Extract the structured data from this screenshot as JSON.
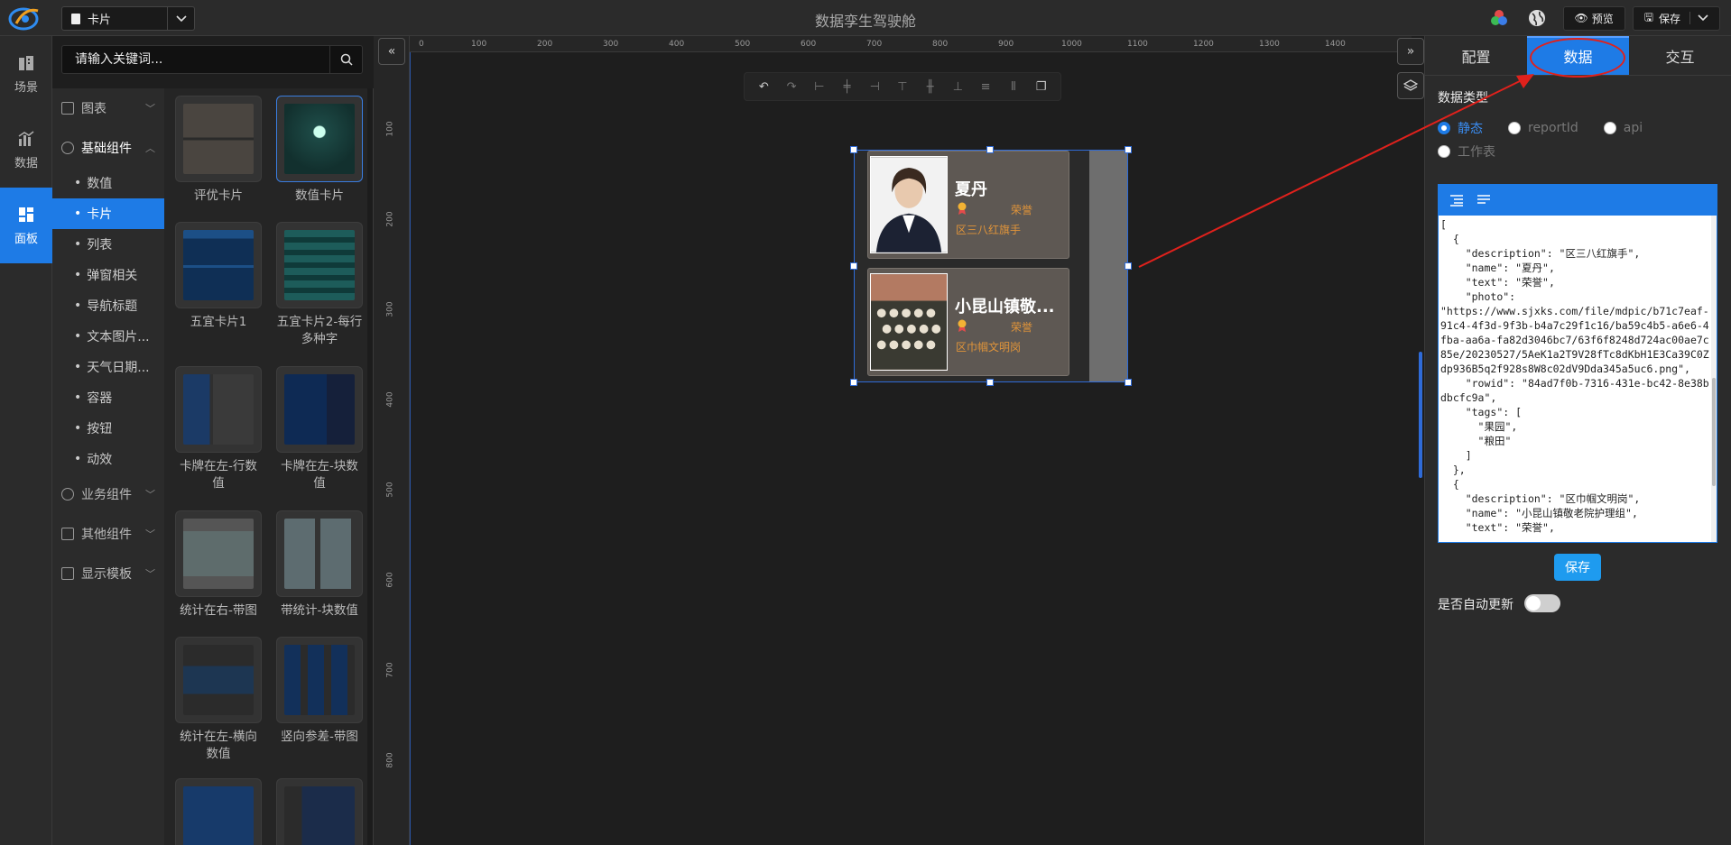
{
  "app_title": "数据孪生驾驶舱",
  "scene_select": {
    "value": "卡片"
  },
  "top_actions": {
    "preview": "预览",
    "save": "保存"
  },
  "left_nav": [
    {
      "label": "场景",
      "icon": "scene-icon"
    },
    {
      "label": "数据",
      "icon": "data-icon"
    },
    {
      "label": "面板",
      "icon": "panel-icon",
      "active": true
    }
  ],
  "search": {
    "placeholder": "请输入关键词..."
  },
  "tree": {
    "groups": [
      {
        "label": "图表",
        "icon": "chart-icon"
      },
      {
        "label": "基础组件",
        "icon": "basic-component-icon",
        "open": true
      },
      {
        "label": "业务组件",
        "icon": "business-component-icon"
      },
      {
        "label": "其他组件",
        "icon": "other-component-icon"
      },
      {
        "label": "显示模板",
        "icon": "template-icon"
      }
    ],
    "items": [
      "数值",
      "卡片",
      "列表",
      "弹窗相关",
      "导航标题",
      "文本图片...",
      "天气日期...",
      "容器",
      "按钮",
      "动效"
    ],
    "active_item": "卡片"
  },
  "palette": [
    {
      "label": "评优卡片"
    },
    {
      "label": "数值卡片",
      "selected": true
    },
    {
      "label": "五宜卡片1"
    },
    {
      "label": "五宜卡片2-每行多种字"
    },
    {
      "label": "卡牌在左-行数值"
    },
    {
      "label": "卡牌在左-块数值"
    },
    {
      "label": "统计在右-带图"
    },
    {
      "label": "带统计-块数值"
    },
    {
      "label": "统计在左-横向数值"
    },
    {
      "label": "竖向参差-带图"
    },
    {
      "label": ""
    },
    {
      "label": ""
    }
  ],
  "ruler": {
    "h_ticks": [
      "0",
      "100",
      "200",
      "300",
      "400",
      "500",
      "600",
      "700",
      "800",
      "900",
      "1000",
      "1100",
      "1200",
      "1300",
      "1400"
    ],
    "v_ticks": [
      "100",
      "200",
      "300",
      "400",
      "500",
      "600",
      "700",
      "800"
    ]
  },
  "cards": [
    {
      "name": "夏丹",
      "text": "荣誉",
      "description": "区三八红旗手"
    },
    {
      "name": "小昆山镇敬...",
      "text": "荣誉",
      "description": "区巾帼文明岗"
    }
  ],
  "right_panel": {
    "tabs": [
      "配置",
      "数据",
      "交互"
    ],
    "active_tab": "数据",
    "data_type_label": "数据类型",
    "radios": [
      "静态",
      "reportId",
      "api",
      "工作表"
    ],
    "selected_radio": "静态",
    "json_text": "[\n  {\n    \"description\": \"区三八红旗手\",\n    \"name\": \"夏丹\",\n    \"text\": \"荣誉\",\n    \"photo\":\n\"https://www.sjxks.com/file/mdpic/b71c7eaf-91c4-4f3d-9f3b-b4a7c29f1c16/ba59c4b5-a6e6-4fba-aa6a-fa82d3046bc7/63f6f8248d724ac00ae7c85e/20230527/5AeK1a2T9V28fTc8dKbH1E3Ca39C0Zdp936B5q2f928s8W8c02dV9Dda345a5uc6.png\",\n    \"rowid\": \"84ad7f0b-7316-431e-bc42-8e38bdbcfc9a\",\n    \"tags\": [\n      \"果园\",\n      \"粮田\"\n    ]\n  },\n  {\n    \"description\": \"区巾帼文明岗\",\n    \"name\": \"小昆山镇敬老院护理组\",\n    \"text\": \"荣誉\",",
    "save_label": "保存",
    "auto_update_label": "是否自动更新",
    "auto_update": false
  },
  "colors": {
    "accent": "#1e7be6",
    "highlight": "#e0211c",
    "card_text": "#e0943a"
  }
}
